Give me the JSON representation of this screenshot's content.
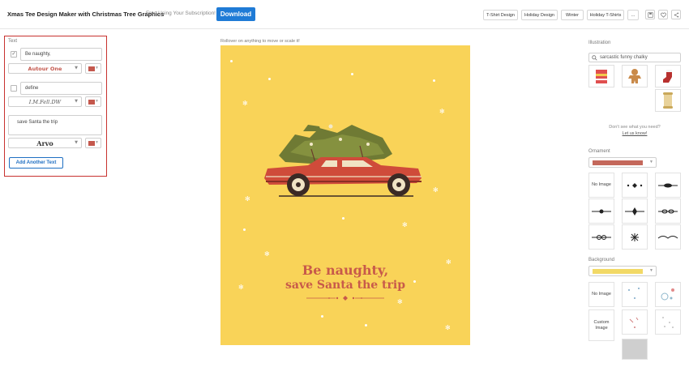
{
  "header": {
    "title": "Xmas Tee Design Maker with Christmas Tree Graphics",
    "subscription_note": "Free Using Your Subscription!",
    "download_label": "Download",
    "tags": [
      "T-Shirt Design",
      "Holiday Design",
      "Winter",
      "Holiday T-Shirts"
    ],
    "more_label": "...",
    "tool_icons": [
      "save-icon",
      "heart-icon",
      "share-icon"
    ]
  },
  "text_panel": {
    "label": "Text",
    "entries": [
      {
        "checked": true,
        "value": "Be naughty,",
        "font": "Autour One",
        "color": "#c4584d"
      },
      {
        "checked": false,
        "value": "define",
        "font": "I.M.Fell.DW",
        "color": "#c4584d"
      },
      {
        "checked": true,
        "value": "save Santa the trip",
        "font": "Arvo",
        "color": "#c4584d"
      }
    ],
    "add_button": "Add Another Text"
  },
  "canvas": {
    "hint": "Rollover on anything to move or scale it!",
    "background_color": "#f9d358",
    "line1": "Be naughty,",
    "line2": "save Santa the trip",
    "text_color": "#c85a4a",
    "car_color": "#cf4b3a"
  },
  "illustration": {
    "label": "Illustration",
    "search_value": "sarcastic funny chalky",
    "thumbs": [
      "sweater-icon",
      "gingerbread-icon",
      "stocking-icon",
      "scroll-icon"
    ],
    "help_text": "Don't see what you need?",
    "help_link": "Let us know!"
  },
  "ornament": {
    "label": "Ornament",
    "selected_color": "#c4685b",
    "no_image_label": "No Image"
  },
  "background": {
    "label": "Background",
    "selected_color": "#f2d966",
    "no_image_label": "No Image",
    "custom_image_label": "Custom Image"
  }
}
